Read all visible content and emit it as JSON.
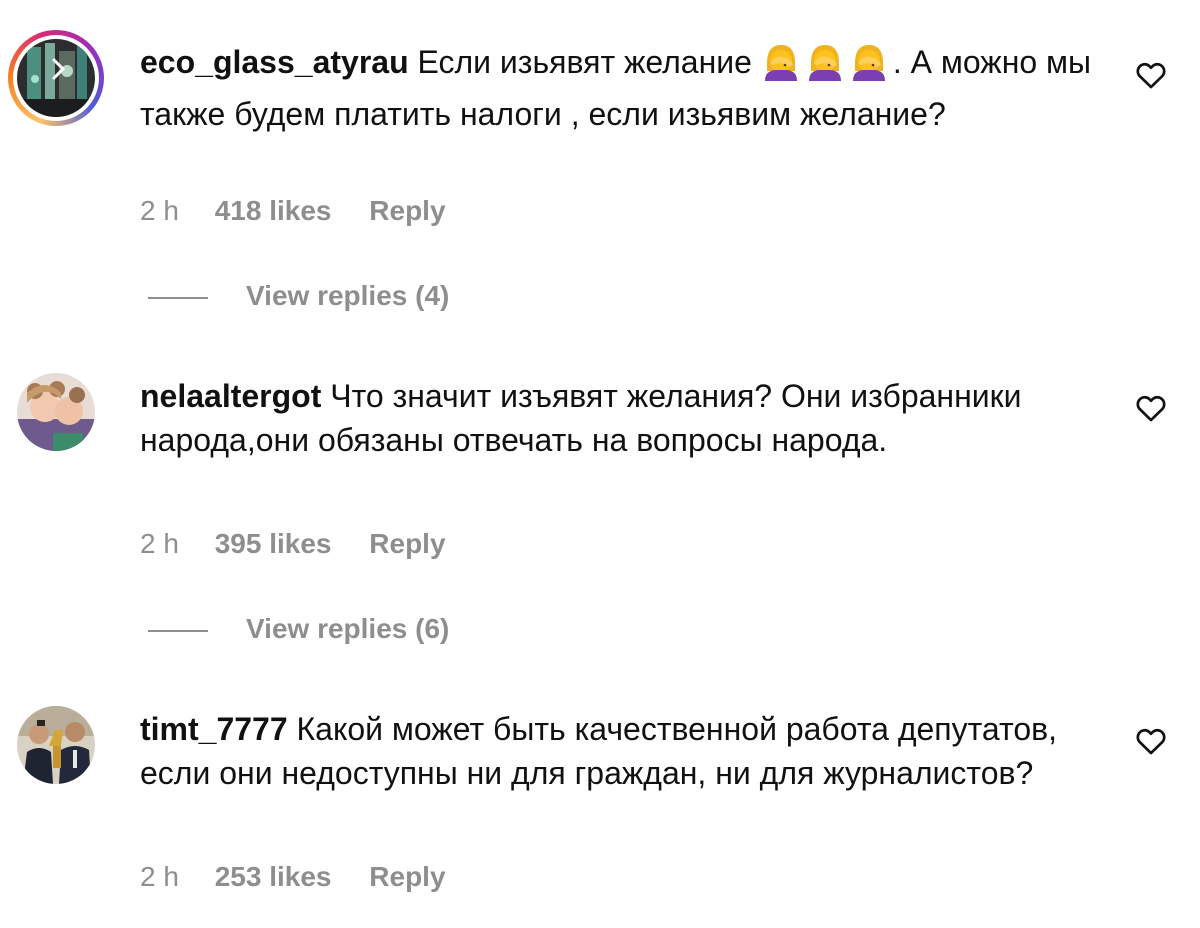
{
  "comments": [
    {
      "username": "eco_glass_atyrau",
      "text_before": "Если изьявят желание",
      "emoji": [
        "woman-facepalming",
        "woman-facepalming",
        "woman-facepalming"
      ],
      "text_after": ". А можно мы также будем платить налоги , если изьявим желание?",
      "time": "2 h",
      "likes": "418 likes",
      "reply": "Reply",
      "view_replies": "View replies (4)"
    },
    {
      "username": "nelaaltergot",
      "text": "Что значит изъявят желания? Они избранники народа,они обязаны отвечать на вопросы народа.",
      "time": "2 h",
      "likes": "395 likes",
      "reply": "Reply",
      "view_replies": "View replies (6)"
    },
    {
      "username": "timt_7777",
      "text": "Какой может быть качественной работа депутатов, если они недоступны ни для граждан, ни для журналистов?",
      "time": "2 h",
      "likes": "253 likes",
      "reply": "Reply"
    }
  ],
  "icons": {
    "like": "heart-outline-icon",
    "emoji": "woman-facepalming-emoji"
  },
  "colors": {
    "text": "#111111",
    "secondary": "#8e8e8e",
    "story_ring": [
      "#fdc468",
      "#fa7e1e",
      "#d62976",
      "#962fbf",
      "#4f5bd5"
    ]
  }
}
